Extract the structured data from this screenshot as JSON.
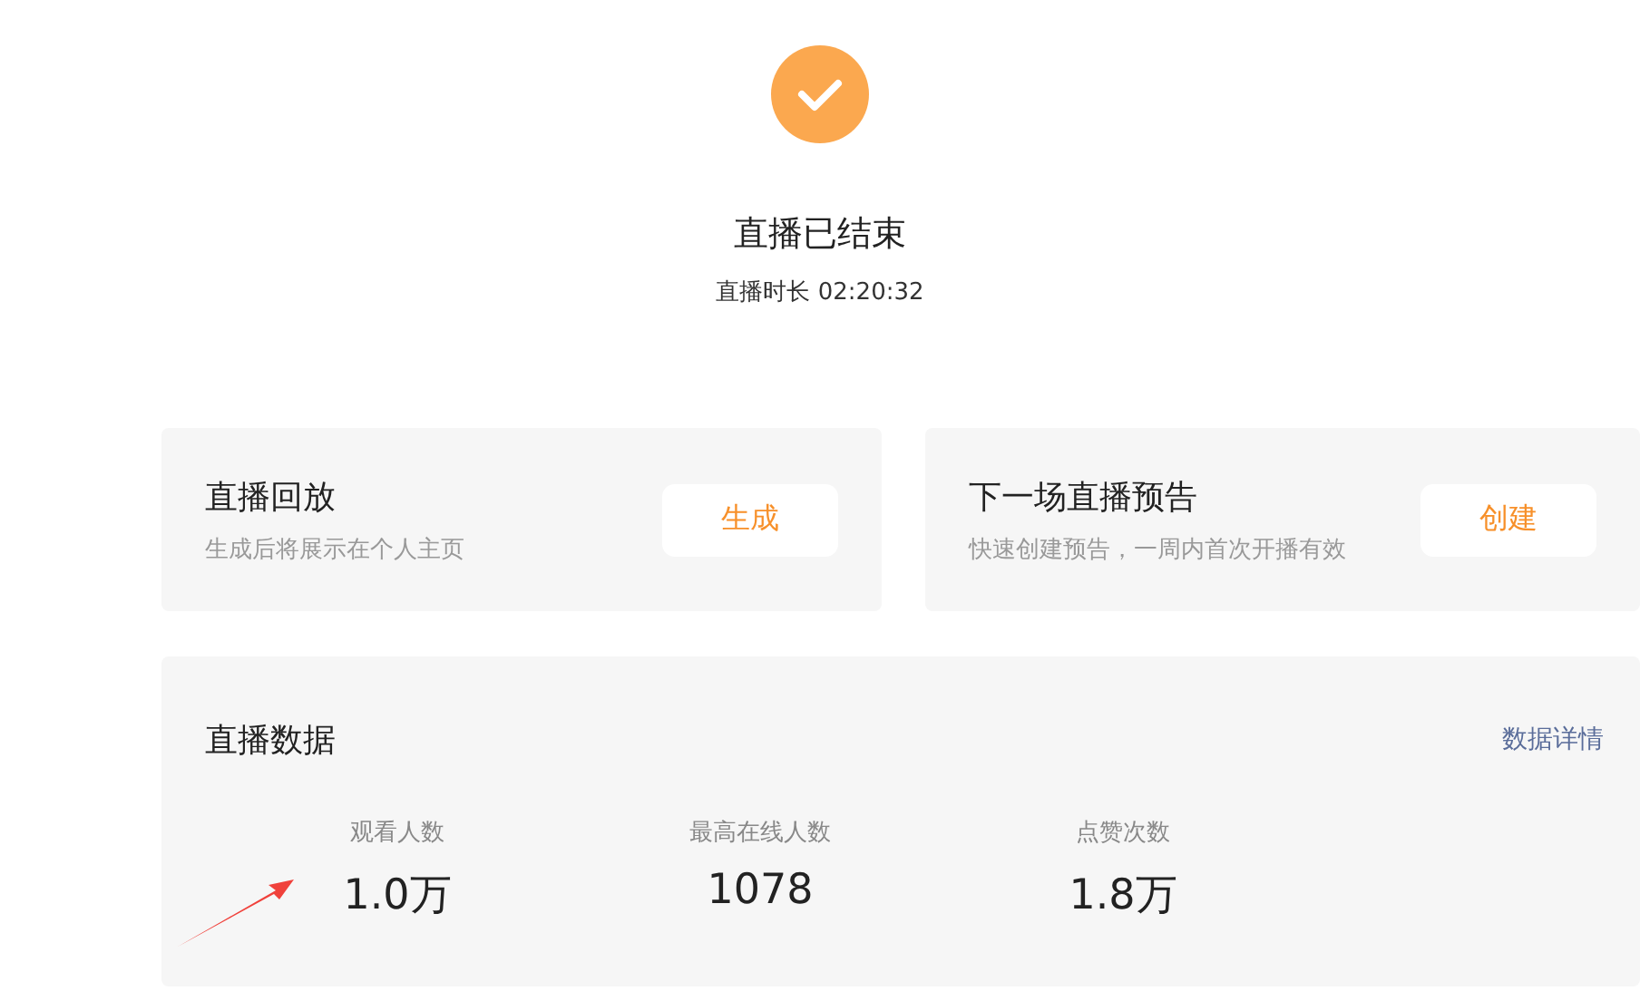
{
  "status": {
    "title": "直播已结束",
    "duration_label": "直播时长",
    "duration": "02:20:32"
  },
  "cards": [
    {
      "title": "直播回放",
      "subtitle": "生成后将展示在个人主页",
      "button": "生成"
    },
    {
      "title": "下一场直播预告",
      "subtitle": "快速创建预告，一周内首次开播有效",
      "button": "创建"
    }
  ],
  "stats": {
    "title": "直播数据",
    "link": "数据详情",
    "items": [
      {
        "label": "观看人数",
        "value": "1.0万"
      },
      {
        "label": "最高在线人数",
        "value": "1078"
      },
      {
        "label": "点赞次数",
        "value": "1.8万"
      }
    ]
  }
}
